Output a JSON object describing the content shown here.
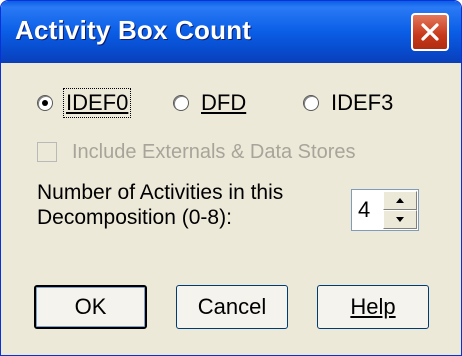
{
  "window": {
    "title": "Activity Box Count",
    "close_icon": "close-x-icon",
    "titlebar_color": "#0a5ee6",
    "close_color": "#d2472a"
  },
  "radio_options": [
    {
      "label": "IDEF0",
      "checked": true
    },
    {
      "label": "DFD",
      "checked": false
    },
    {
      "label": "IDEF3",
      "checked": false
    }
  ],
  "checkbox": {
    "label": "Include Externals & Data Stores",
    "checked": false,
    "disabled": true
  },
  "activities": {
    "label_line1": "Number of Activities in this",
    "label_line2": "Decomposition (0-8):",
    "value": "4"
  },
  "buttons": {
    "ok": "OK",
    "cancel": "Cancel",
    "help": "Help"
  }
}
